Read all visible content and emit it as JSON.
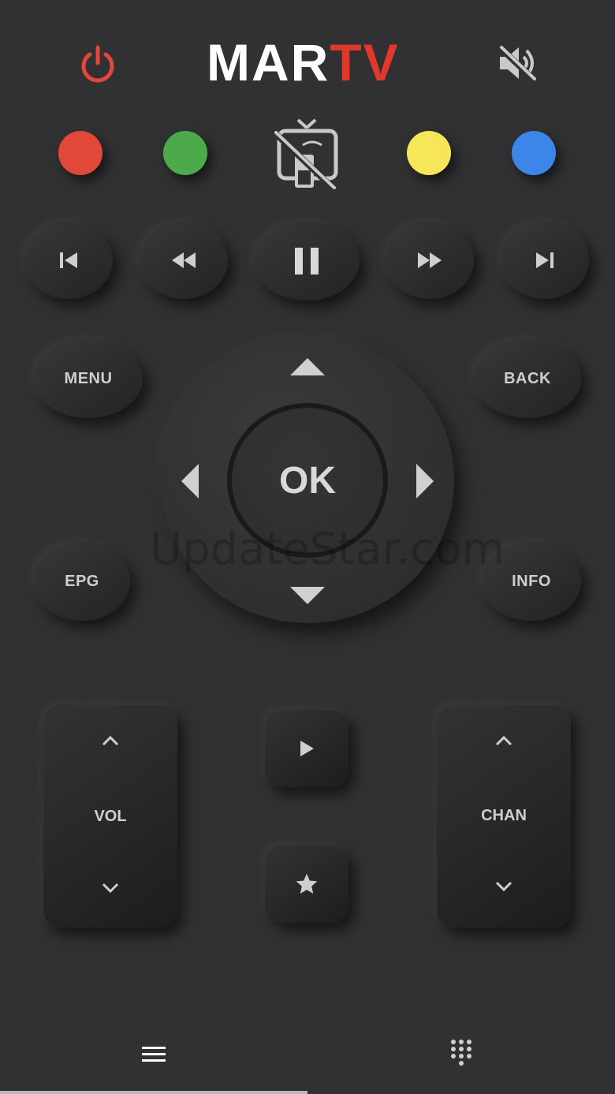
{
  "header": {
    "logo_part1": "MAR",
    "logo_part2": "TV",
    "power_icon": "power-icon",
    "mute_icon": "mute-icon"
  },
  "color_buttons": {
    "red": "#e2483a",
    "green": "#4caa4a",
    "yellow": "#f7e55a",
    "blue": "#3b86e8",
    "cast_icon": "tv-cast-off-icon"
  },
  "media": {
    "skip_prev_icon": "skip-previous-icon",
    "rewind_icon": "rewind-icon",
    "pause_icon": "pause-icon",
    "fast_forward_icon": "fast-forward-icon",
    "skip_next_icon": "skip-next-icon"
  },
  "nav": {
    "menu": "MENU",
    "back": "BACK",
    "epg": "EPG",
    "info": "INFO",
    "ok": "OK"
  },
  "rockers": {
    "vol": "VOL",
    "chan": "CHAN"
  },
  "watermark": "UpdateStar.com",
  "bottom_nav": {
    "menu_icon": "hamburger-menu-icon",
    "keypad_icon": "numeric-keypad-icon"
  }
}
